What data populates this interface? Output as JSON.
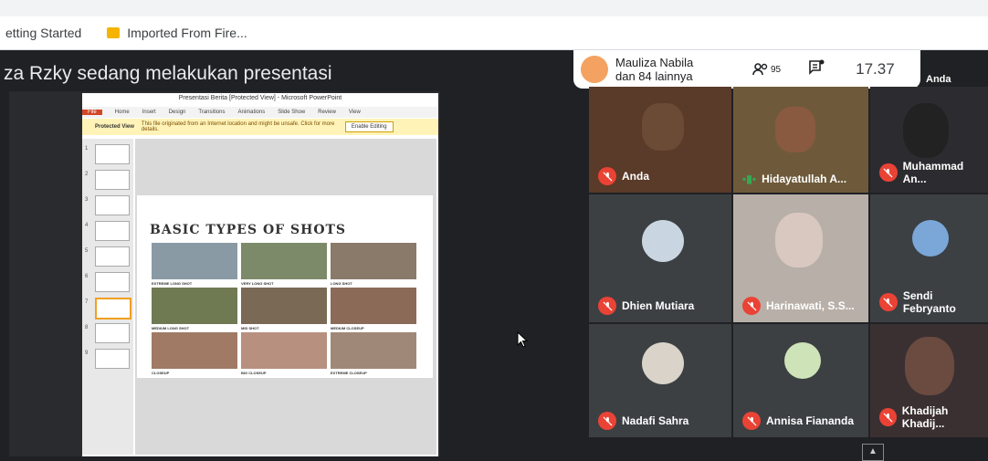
{
  "browser": {
    "bookmarks": [
      "etting Started",
      "Imported From Fire..."
    ]
  },
  "presentation": {
    "title": "za Rzky sedang melakukan presentasi"
  },
  "powerpoint": {
    "window_title": "Presentasi Berita [Protected View] - Microsoft PowerPoint",
    "tabs": [
      "File",
      "Home",
      "Insert",
      "Design",
      "Transitions",
      "Animations",
      "Slide Show",
      "Review",
      "View"
    ],
    "protected_label": "Protected View",
    "protected_text": "This file originated from an Internet location and might be unsafe. Click for more details.",
    "enable_editing": "Enable Editing",
    "slide_numbers": [
      "1",
      "2",
      "3",
      "4",
      "5",
      "6",
      "7",
      "8",
      "9"
    ],
    "slide_heading": "BASIC TYPES OF SHOTS",
    "shot_labels": [
      "EXTREME LONG SHOT",
      "VERY LONG SHOT",
      "LONG SHOT",
      "MEDIUM LONG SHOT",
      "MID SHOT",
      "MEDIUM CLOSEUP",
      "CLOSEUP",
      "BIG CLOSEUP",
      "EXTREME CLOSEUP"
    ]
  },
  "info_bar": {
    "presenter_line1": "Mauliza Nabila",
    "presenter_line2": "dan 84 lainnya",
    "participant_count": "95",
    "clock": "17.37"
  },
  "participants": [
    "Anda",
    "Hidayatullah A...",
    "Muhammad An...",
    "Dhien Mutiara",
    "Harinawati, S.S...",
    "Sendi Febryanto",
    "Nadafi Sahra",
    "Annisa Fiananda",
    "Khadijah Khadij..."
  ],
  "self_label": "Anda",
  "colors": {
    "mic_off": "#ea4335",
    "speaking": "#34a853",
    "meet_bg": "#202124"
  }
}
